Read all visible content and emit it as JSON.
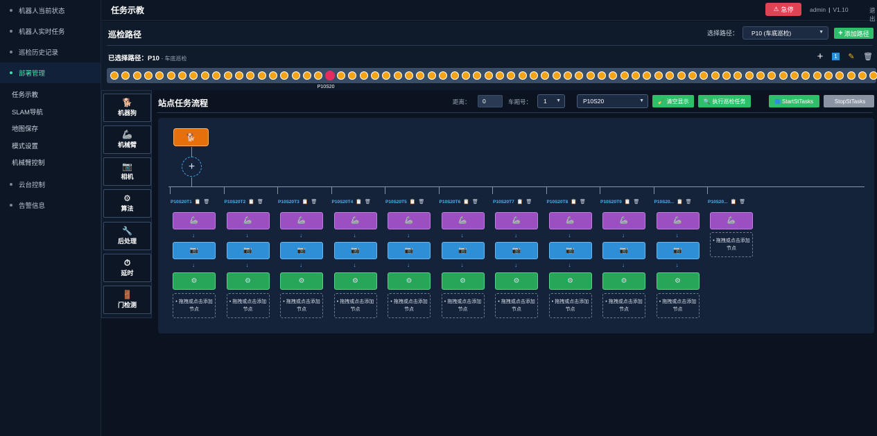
{
  "sidebar": {
    "top_items": [
      {
        "label": "机器人当前状态"
      },
      {
        "label": "机器人实时任务"
      },
      {
        "label": "巡检历史记录"
      },
      {
        "label": "部署管理"
      }
    ],
    "sub_items": [
      {
        "label": "任务示教"
      },
      {
        "label": "SLAM导航"
      },
      {
        "label": "地图保存"
      },
      {
        "label": "模式设置"
      },
      {
        "label": "机械臂控制"
      }
    ],
    "bottom_items": [
      {
        "label": "云台控制"
      },
      {
        "label": "告警信息"
      }
    ]
  },
  "header": {
    "title": "任务示教",
    "estop_label": "急停",
    "estop_icon": "⚠",
    "user": "admin",
    "separator": "|",
    "version": "V1.10",
    "logout": "退出"
  },
  "route": {
    "title": "巡检路径",
    "select_label": "选择路径：",
    "select_value": "P10 (车底巡检)",
    "add_label": "添加路径",
    "selected_prefix": "已选择路径：",
    "selected_id": "P10",
    "selected_sub": "- 车底巡检",
    "active_station": "P10S20",
    "station_count": 68,
    "active_index": 19,
    "tools": {
      "add": "+",
      "count": "1",
      "edit": "✎",
      "delete": "🗑"
    }
  },
  "palette": [
    {
      "label": "机器狗",
      "icon": "🐕"
    },
    {
      "label": "机械臂",
      "icon": "🦾"
    },
    {
      "label": "相机",
      "icon": "📷"
    },
    {
      "label": "算法",
      "icon": "⚙"
    },
    {
      "label": "后处理",
      "icon": "🔧"
    },
    {
      "label": "延时",
      "icon": "⏱"
    },
    {
      "label": "门检测",
      "icon": "🚪"
    }
  ],
  "flow": {
    "title": "站点任务流程",
    "distance_label": "距离：",
    "distance_value": "0",
    "car_label": "车厢号：",
    "car_value": "1",
    "station_value": "P10S20",
    "clear_label": "清空显示",
    "run_label": "执行巡检任务",
    "start_label": "StartStTasks",
    "stop_label": "StopStTasks"
  },
  "canvas": {
    "robot_icon": "🐕",
    "add_icon": "+",
    "drop_text": "• 拖拽或点击添加节点",
    "node_icons": {
      "arm": "🦾",
      "cam": "📷",
      "alg": "⚙"
    },
    "arrow": "↓",
    "head_icons": {
      "copy": "📋",
      "delete": "🗑"
    },
    "columns": [
      {
        "label": "P10S20T1",
        "full": true
      },
      {
        "label": "P10S20T2",
        "full": true
      },
      {
        "label": "P10S20T3",
        "full": true
      },
      {
        "label": "P10S20T4",
        "full": true
      },
      {
        "label": "P10S20T5",
        "full": true
      },
      {
        "label": "P10S20T6",
        "full": true
      },
      {
        "label": "P10S20T7",
        "full": true
      },
      {
        "label": "P10S20T8",
        "full": true
      },
      {
        "label": "P10S20T9",
        "full": true
      },
      {
        "label": "P10S20...",
        "full": true
      },
      {
        "label": "P10S20...",
        "full": false
      }
    ]
  }
}
